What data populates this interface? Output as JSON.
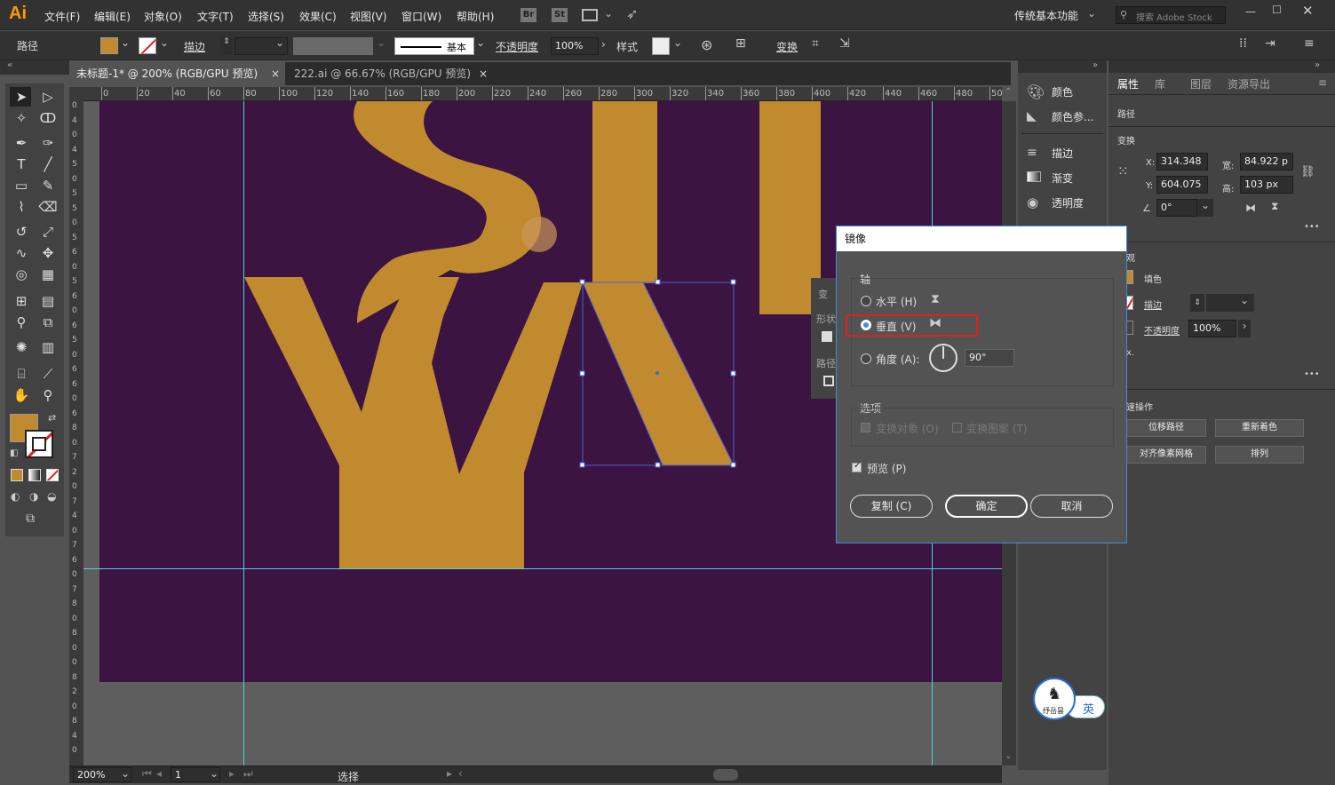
{
  "app": {
    "logo": "Ai",
    "menu": [
      "文件(F)",
      "编辑(E)",
      "对象(O)",
      "文字(T)",
      "选择(S)",
      "效果(C)",
      "视图(V)",
      "窗口(W)",
      "帮助(H)"
    ],
    "br": "Br",
    "st": "St",
    "workspace": "传统基本功能",
    "search_placeholder": "搜索 Adobe Stock"
  },
  "options": {
    "object_type": "路径",
    "stroke_label": "描边",
    "stroke_style": "基本",
    "opacity_label": "不透明度",
    "opacity_value": "100%",
    "style_label": "样式",
    "transform_label": "变换"
  },
  "tabs": [
    {
      "label": "未标题-1* @ 200% (RGB/GPU 预览)"
    },
    {
      "label": "222.ai @ 66.67% (RGB/GPU 预览)"
    }
  ],
  "ruler": {
    "h_ticks": [
      "0",
      "20",
      "40",
      "60",
      "80",
      "100",
      "120",
      "140",
      "160",
      "180",
      "200",
      "220",
      "240",
      "260",
      "280",
      "300",
      "320",
      "340",
      "360",
      "380",
      "400",
      "420",
      "440",
      "460",
      "480",
      "50"
    ],
    "v_ticks": [
      "0",
      "4",
      "0",
      "4",
      "5",
      "0",
      "5",
      "5",
      "0",
      "5",
      "6",
      "0",
      "5",
      "6",
      "0",
      "6",
      "5",
      "0",
      "6",
      "6",
      "0",
      "6",
      "8",
      "0",
      "7",
      "2",
      "0",
      "7",
      "4",
      "0",
      "7",
      "6",
      "0",
      "7",
      "8",
      "0",
      "8",
      "0",
      "0",
      "8",
      "2",
      "0",
      "8",
      "4",
      "0"
    ]
  },
  "status": {
    "zoom": "200%",
    "page": "1",
    "tool": "选择"
  },
  "mid_panel": {
    "items": [
      "颜色",
      "颜色参...",
      "描边",
      "渐变",
      "透明度"
    ]
  },
  "props": {
    "tabs": [
      "属性",
      "库",
      "图层",
      "资源导出"
    ],
    "section_path": "路径",
    "section_transform": "变换",
    "x_label": "X:",
    "x_value": "314.348",
    "y_label": "Y:",
    "y_value": "604.075",
    "w_label": "宽:",
    "w_value": "84.922 p",
    "h_label": "高:",
    "h_value": "103 px",
    "angle_value": "0°",
    "appearance_label": "观",
    "fill_label": "填色",
    "stroke_label": "描边",
    "opacity_label": "不透明度",
    "opacity_value": "100%",
    "fx_label": "x.",
    "quick_label": "速操作",
    "btn_offset": "位移路径",
    "btn_recolor": "重新着色",
    "btn_align_pixel": "对齐像素网格",
    "btn_arrange": "排列",
    "more": "•••"
  },
  "float_panel": {
    "label1": "变",
    "label2": "形状",
    "label3": "路径"
  },
  "dialog": {
    "title": "镜像",
    "axis_label": "轴",
    "horizontal": "水平 (H)",
    "vertical": "垂直 (V)",
    "angle_label": "角度 (A):",
    "angle_value": "90°",
    "options_label": "选项",
    "transform_objects": "变换对象 (O)",
    "transform_patterns": "变换图案 (T)",
    "preview": "预览 (P)",
    "copy_btn": "复制 (C)",
    "ok_btn": "确定",
    "cancel_btn": "取消"
  },
  "ime": {
    "label": "英",
    "logo_text": "纾岳昙"
  },
  "colors": {
    "accent": "#c28a2e",
    "artboard": "#3c1441",
    "guide": "#52d0e0",
    "selection": "#4a5fd8",
    "highlight": "#e02020"
  }
}
